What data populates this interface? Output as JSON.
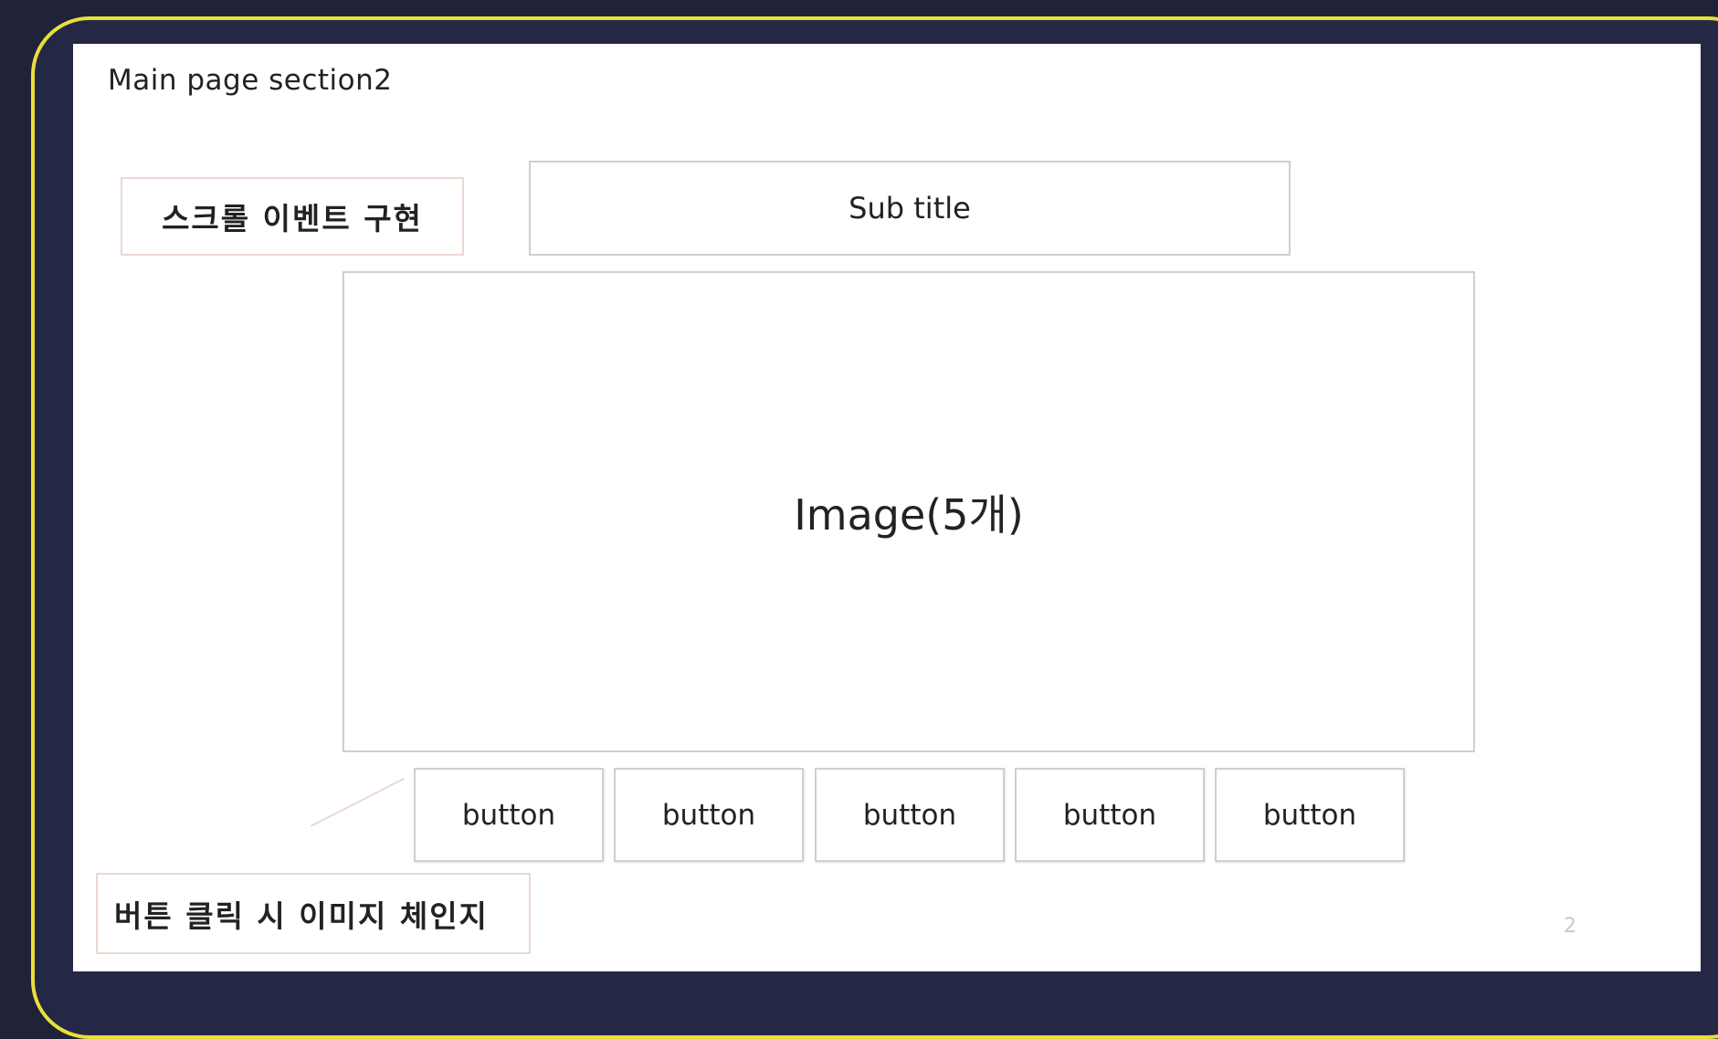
{
  "slide": {
    "title": "Main page section2",
    "page_number": "2"
  },
  "notes": {
    "scroll_event": "스크롤 이벤트 구현",
    "button_click": "버튼 클릭 시 이미지 체인지"
  },
  "content": {
    "subtitle": "Sub title",
    "image_placeholder": "Image(5개)",
    "buttons": [
      "button",
      "button",
      "button",
      "button",
      "button"
    ]
  },
  "colors": {
    "frame_border": "#e8e03a",
    "background": "#1f2238",
    "note_border": "#ead8d0"
  }
}
